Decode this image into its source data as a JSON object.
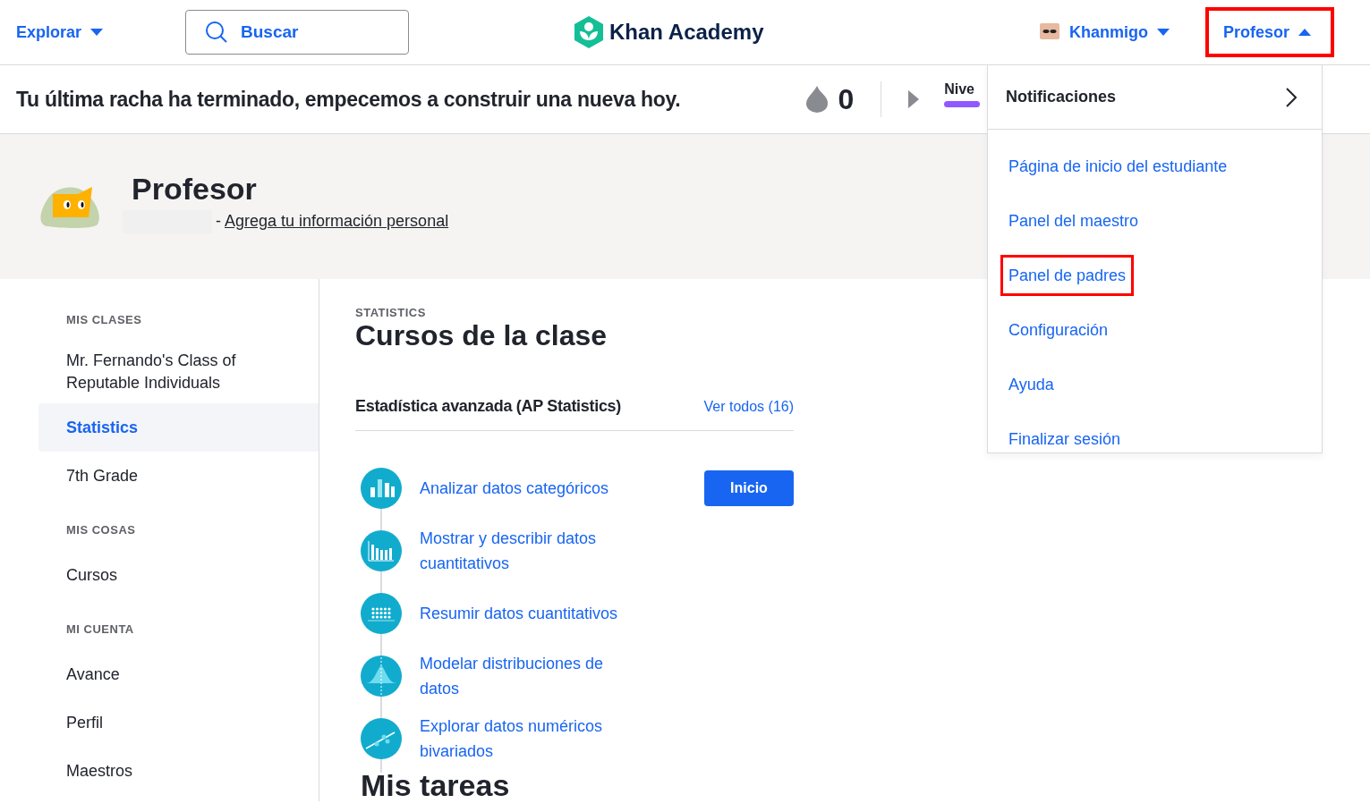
{
  "header": {
    "explore": "Explorar",
    "search": {
      "placeholder": "Buscar"
    },
    "logo": "Khan Academy",
    "khanmigo": "Khanmigo",
    "profile_menu": {
      "label": "Profesor",
      "expanded": true,
      "highlighted": true
    }
  },
  "streak": {
    "message": "Tu última racha ha terminado, empecemos a construir una nueva hoy.",
    "count": "0",
    "level_label": "Nive"
  },
  "profile": {
    "name": "Profesor",
    "link_prefix": "-",
    "link": "Agrega tu información personal"
  },
  "sidebar": [
    {
      "heading": "MIS CLASES",
      "items": [
        {
          "label": "Mr. Fernando's Class of Reputable Individuals",
          "selected": false
        },
        {
          "label": "Statistics",
          "selected": true
        },
        {
          "label": "7th Grade",
          "selected": false
        }
      ]
    },
    {
      "heading": "MIS COSAS",
      "items": [
        {
          "label": "Cursos",
          "selected": false
        }
      ]
    },
    {
      "heading": "MI CUENTA",
      "items": [
        {
          "label": "Avance",
          "selected": false
        },
        {
          "label": "Perfil",
          "selected": false
        },
        {
          "label": "Maestros",
          "selected": false
        }
      ]
    }
  ],
  "main": {
    "eyebrow": "STATISTICS",
    "title": "Cursos de la clase",
    "course": {
      "name": "Estadística avanzada (AP Statistics)",
      "see_all": "Ver todos (16)",
      "start_button": "Inicio",
      "units": [
        {
          "kind": "bars",
          "label": "Analizar datos categóricos"
        },
        {
          "kind": "histogram",
          "label": "Mostrar y describir datos cuantitativos"
        },
        {
          "kind": "dots",
          "label": "Resumir datos cuantitativos"
        },
        {
          "kind": "bell",
          "label": "Modelar distribuciones de datos"
        },
        {
          "kind": "scatter",
          "label": "Explorar datos numéricos bivariados"
        }
      ]
    },
    "section_title": "Mis tareas"
  },
  "dropdown": {
    "notifications": "Notificaciones",
    "items": [
      {
        "label": "Página de inicio del estudiante",
        "highlighted": false
      },
      {
        "label": "Panel del maestro",
        "highlighted": false
      },
      {
        "label": "Panel de padres",
        "highlighted": true
      },
      {
        "label": "Configuración",
        "highlighted": false
      },
      {
        "label": "Ayuda",
        "highlighted": false
      },
      {
        "label": "Finalizar sesión",
        "highlighted": false
      }
    ]
  }
}
